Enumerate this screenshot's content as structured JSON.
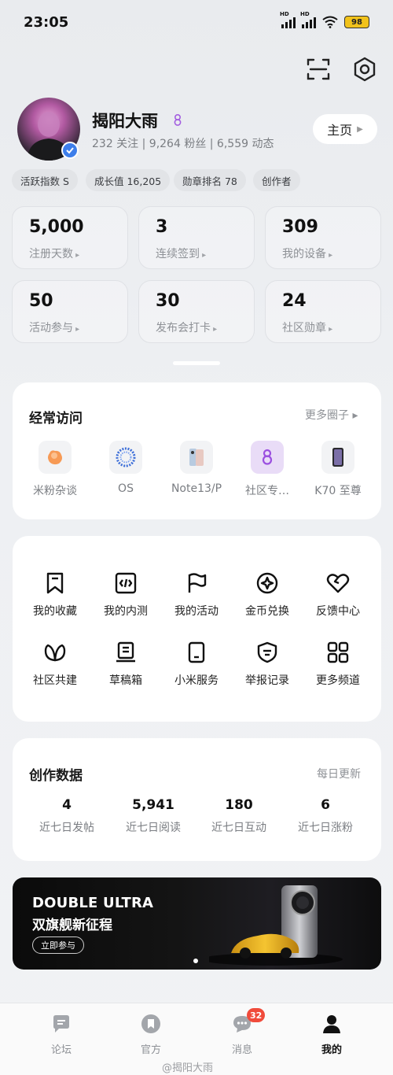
{
  "status_bar": {
    "time": "23:05",
    "battery": "98",
    "hd1": "HD",
    "hd2": "HD"
  },
  "profile": {
    "name": "揭阳大雨",
    "counts": "232 关注 | 9,264 粉丝 | 6,559 动态",
    "home_label": "主页",
    "tags": [
      "活跃指数 S",
      "成长值 16,205",
      "勋章排名 78",
      "创作者"
    ]
  },
  "stats": [
    {
      "value": "5,000",
      "label": "注册天数"
    },
    {
      "value": "3",
      "label": "连续签到"
    },
    {
      "value": "309",
      "label": "我的设备"
    },
    {
      "value": "50",
      "label": "活动参与"
    },
    {
      "value": "30",
      "label": "发布会打卡"
    },
    {
      "value": "24",
      "label": "社区勋章"
    }
  ],
  "frequent": {
    "title": "经常访问",
    "more": "更多圈子 ▸",
    "items": [
      {
        "label": "米粉杂谈",
        "icon": "hand-icon"
      },
      {
        "label": "OS",
        "icon": "os-ring-icon"
      },
      {
        "label": "Note13/P",
        "icon": "phone-icon"
      },
      {
        "label": "社区专…",
        "icon": "community-icon"
      },
      {
        "label": "K70 至尊",
        "icon": "k70-phone-icon"
      }
    ]
  },
  "functions": [
    {
      "label": "我的收藏",
      "icon": "bookmark-icon"
    },
    {
      "label": "我的内测",
      "icon": "code-icon"
    },
    {
      "label": "我的活动",
      "icon": "flag-icon"
    },
    {
      "label": "金币兑换",
      "icon": "coin-icon"
    },
    {
      "label": "反馈中心",
      "icon": "heart-icon"
    },
    {
      "label": "社区共建",
      "icon": "leaf-icon"
    },
    {
      "label": "草稿箱",
      "icon": "draft-icon"
    },
    {
      "label": "小米服务",
      "icon": "device-icon"
    },
    {
      "label": "举报记录",
      "icon": "shield-icon"
    },
    {
      "label": "更多频道",
      "icon": "grid-icon"
    }
  ],
  "creation": {
    "title": "创作数据",
    "update": "每日更新",
    "items": [
      {
        "value": "4",
        "label": "近七日发帖"
      },
      {
        "value": "5,941",
        "label": "近七日阅读"
      },
      {
        "value": "180",
        "label": "近七日互动"
      },
      {
        "value": "6",
        "label": "近七日涨粉"
      }
    ]
  },
  "banner": {
    "line1": "DOUBLE ULTRA",
    "line2": "双旗舰新征程",
    "button": "立即参与"
  },
  "nav": {
    "items": [
      {
        "label": "论坛",
        "icon": "forum-icon"
      },
      {
        "label": "官方",
        "icon": "official-icon"
      },
      {
        "label": "消息",
        "icon": "message-icon"
      },
      {
        "label": "我的",
        "icon": "profile-icon"
      }
    ],
    "badge": "32"
  },
  "watermark": "@揭阳大雨",
  "colors": {
    "accent": "#3d7eea",
    "badge": "#f04b3b",
    "battery": "#f1c21b"
  }
}
